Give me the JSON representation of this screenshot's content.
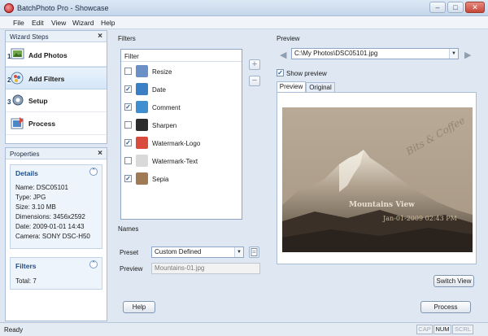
{
  "window": {
    "title": "BatchPhoto Pro - Showcase",
    "min_icon": "minimize-icon",
    "max_icon": "maximize-icon",
    "close_icon": "close-icon"
  },
  "menu": [
    "File",
    "Edit",
    "View",
    "Wizard",
    "Help"
  ],
  "wizard": {
    "title": "Wizard Steps",
    "close": "×",
    "steps": [
      {
        "num": "1",
        "label": "Add Photos",
        "icon": "add-photos-icon"
      },
      {
        "num": "2",
        "label": "Add Filters",
        "icon": "add-filters-icon",
        "active": true
      },
      {
        "num": "3",
        "label": "Setup",
        "icon": "setup-icon"
      },
      {
        "num": "",
        "label": "Process",
        "icon": "process-icon"
      }
    ]
  },
  "properties": {
    "title": "Properties",
    "close": "×",
    "details": {
      "title": "Details",
      "lines": [
        "Name: DSC05101",
        "Type: JPG",
        "Size: 3.10 MB",
        "Dimensions: 3456x2592",
        "Date: 2009-01-01 14:43",
        "Camera: SONY DSC-H50"
      ]
    },
    "filters": {
      "title": "Filters",
      "total": "Total: 7"
    }
  },
  "filters_panel": {
    "title": "Filters",
    "list_header": "Filter",
    "add_btn": "+",
    "remove_btn": "−",
    "items": [
      {
        "label": "Resize",
        "checked": false,
        "icon": "resize-icon",
        "color": "#6b8fc7"
      },
      {
        "label": "Date",
        "checked": true,
        "icon": "date-icon",
        "color": "#3b7fc4"
      },
      {
        "label": "Comment",
        "checked": true,
        "icon": "comment-icon",
        "color": "#3f8fd0"
      },
      {
        "label": "Sharpen",
        "checked": false,
        "icon": "sharpen-icon",
        "color": "#2c2c2c"
      },
      {
        "label": "Watermark-Logo",
        "checked": true,
        "icon": "watermark-logo-icon",
        "color": "#d94b3d"
      },
      {
        "label": "Watermark-Text",
        "checked": false,
        "icon": "watermark-text-icon",
        "color": "#d9d9d9"
      },
      {
        "label": "Sepia",
        "checked": true,
        "icon": "sepia-icon",
        "color": "#a07a55"
      }
    ]
  },
  "names": {
    "title": "Names",
    "preset_label": "Preset",
    "preset_value": "Custom Defined",
    "preview_label": "Preview",
    "preview_value": "Mountains-01.jpg"
  },
  "preview": {
    "title": "Preview",
    "file": "C:\\My Photos\\DSC05101.jpg",
    "show_preview_label": "Show preview",
    "show_preview_checked": true,
    "tabs": [
      "Preview",
      "Original"
    ],
    "watermark_text": "Bits & Coffee",
    "caption": "Mountains View",
    "date_stamp": "Jan-01-2009 02:43 PM",
    "switch_view": "Switch View",
    "prev_icon": "prev-arrow-icon",
    "next_icon": "next-arrow-icon"
  },
  "footer": {
    "help": "Help",
    "process": "Process"
  },
  "status": {
    "text": "Ready",
    "indicators": [
      {
        "label": "CAP",
        "on": false
      },
      {
        "label": "NUM",
        "on": true
      },
      {
        "label": "SCRL",
        "on": false
      }
    ]
  }
}
